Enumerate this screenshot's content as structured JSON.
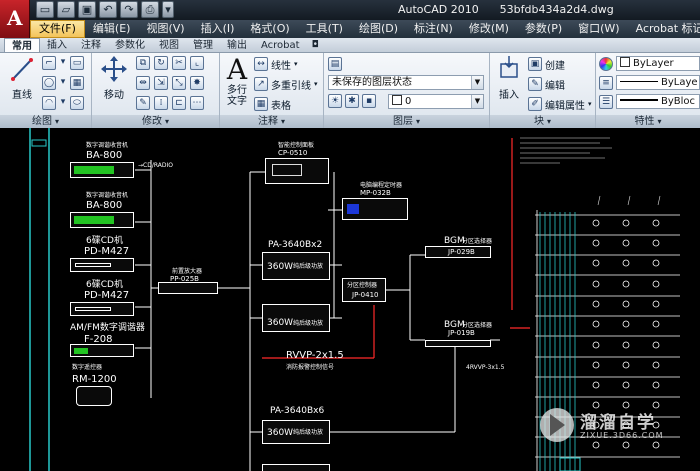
{
  "app": {
    "logo_letter": "A",
    "title": "AutoCAD 2010      53bfdb434a2d4.dwg",
    "quick_access": [
      "new-icon",
      "open-icon",
      "save-icon",
      "undo-icon",
      "redo-icon",
      "plot-icon",
      "dropdown-icon"
    ]
  },
  "menubar": {
    "items": [
      "文件(F)",
      "编辑(E)",
      "视图(V)",
      "插入(I)",
      "格式(O)",
      "工具(T)",
      "绘图(D)",
      "标注(N)",
      "修改(M)",
      "参数(P)",
      "窗口(W)",
      "Acrobat 标记(C)"
    ]
  },
  "ribbon_tabs": {
    "items": [
      "常用",
      "插入",
      "注释",
      "参数化",
      "视图",
      "管理",
      "输出",
      "Acrobat"
    ],
    "collapse_symbol": "◘"
  },
  "ribbon": {
    "draw": {
      "title": "绘图",
      "line_label": "直线"
    },
    "modify": {
      "title": "修改",
      "move_label": "移动"
    },
    "annotation": {
      "title": "注释",
      "mtext_label": "多行\n文字",
      "linear_label": "线性",
      "multileader_label": "多重引线",
      "table_label": "表格"
    },
    "layers": {
      "title": "图层",
      "layer_state": "未保存的图层状态",
      "current_layer": "0"
    },
    "block": {
      "title": "块",
      "insert_label": "插入",
      "create_label": "创建",
      "edit_label": "编辑",
      "edit_attr_label": "编辑属性"
    },
    "properties": {
      "title": "特性",
      "color_value": "ByLayer",
      "linetype_value": "ByLaye",
      "lineweight_value": "ByBloc"
    }
  },
  "drawing": {
    "devices": {
      "tuner1_cn": "数字调谐收音机",
      "tuner1_model": "BA-800",
      "tuner1_note": "→CD/RADIO",
      "tuner2_cn": "数字调谐收音机",
      "tuner2_model": "BA-800",
      "cd1_cn": "6碟CD机",
      "cd1_model": "PD-M427",
      "cd2_cn": "6碟CD机",
      "cd2_model": "PD-M427",
      "amfm_label": "AM/FM数字调谐器",
      "amfm_model": "F-208",
      "remote_cn": "数字遥控器",
      "remote_model": "RM-1200",
      "preamp_cn": "前置放大器",
      "preamp_model": "PP-025B",
      "cp_cn": "智能控制面板",
      "cp_model": "CP-0510",
      "mp_cn": "电脑编程定时器",
      "mp_model": "MP-032B",
      "pa2_label": "PA-3640Bx2",
      "amp1_label": "360W",
      "amp1_note": "纯后级功放",
      "amp2_label": "360W",
      "amp2_note": "纯后级功放",
      "jp0410_cn": "分区控制器",
      "jp0410_model": "JP-0410",
      "bgm1_label": "BGM",
      "bgm1_cn": "分区选择器",
      "bgm1_model": "JP-029B",
      "bgm2_label": "BGM",
      "bgm2_cn": "分区选择器",
      "bgm2_model": "JP-019B",
      "cable_label": "RVVP-2x1.5",
      "cable_note": "消防报警控制信号",
      "pa6_label": "PA-3640Bx6",
      "amp3_label": "360W",
      "amp3_note": "纯后级功放",
      "right_cable": "4RVVP-3x1.5"
    },
    "colors": {
      "box_border": "#ffffff",
      "text": "#ffffff",
      "red_line": "#ff2a2a",
      "green_led": "#23c423",
      "blue_panel": "#1c37d8"
    }
  },
  "watermark": {
    "title": "溜溜自学",
    "url": "ZIXUE.3D66.COM"
  }
}
